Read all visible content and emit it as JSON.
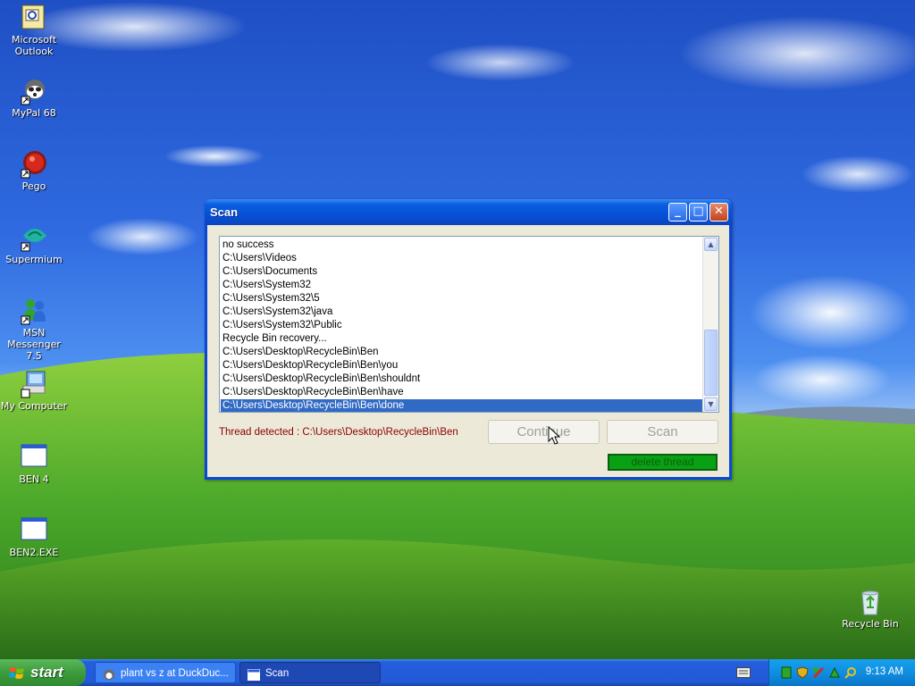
{
  "desktop": {
    "icons": [
      {
        "label": "Microsoft Outlook",
        "line1": "Microsoft",
        "line2": "Outlook"
      },
      {
        "label": "MyPal 68",
        "line1": "MyPal 68"
      },
      {
        "label": "Pego",
        "line1": "Pego"
      },
      {
        "label": "Supermium",
        "line1": "Supermium"
      },
      {
        "label": "MSN Messenger 7.5",
        "line1": "MSN",
        "line2": "Messenger 7.5"
      },
      {
        "label": "My Computer",
        "line1": "My Computer"
      },
      {
        "label": "BEN 4",
        "line1": "BEN 4"
      },
      {
        "label": "BEN2.EXE",
        "line1": "BEN2.EXE"
      },
      {
        "label": "Recycle Bin",
        "line1": "Recycle Bin"
      }
    ]
  },
  "window": {
    "title": "Scan",
    "list_items": [
      "no success",
      "C:\\Users\\Videos",
      "C:\\Users\\Documents",
      "C:\\Users\\System32",
      "C:\\Users\\System32\\5",
      "C:\\Users\\System32\\java",
      "C:\\Users\\System32\\Public",
      "Recycle Bin recovery...",
      "C:\\Users\\Desktop\\RecycleBin\\Ben",
      "C:\\Users\\Desktop\\RecycleBin\\Ben\\you",
      "C:\\Users\\Desktop\\RecycleBin\\Ben\\shouldnt",
      "C:\\Users\\Desktop\\RecycleBin\\Ben\\have",
      "C:\\Users\\Desktop\\RecycleBin\\Ben\\done"
    ],
    "selected_index": 12,
    "status": "Thread detected : C:\\Users\\Desktop\\RecycleBin\\Ben",
    "continue_label": "Continue",
    "scan_label": "Scan",
    "delete_label": "delete thread"
  },
  "taskbar": {
    "start_label": "start",
    "tasks": [
      {
        "label": "plant vs z at DuckDuc..."
      },
      {
        "label": "Scan"
      }
    ],
    "clock": "9:13 AM"
  },
  "colors": {
    "selection": "#316ac5",
    "status_text": "#8b0000",
    "delete_button": "#0aa014"
  }
}
